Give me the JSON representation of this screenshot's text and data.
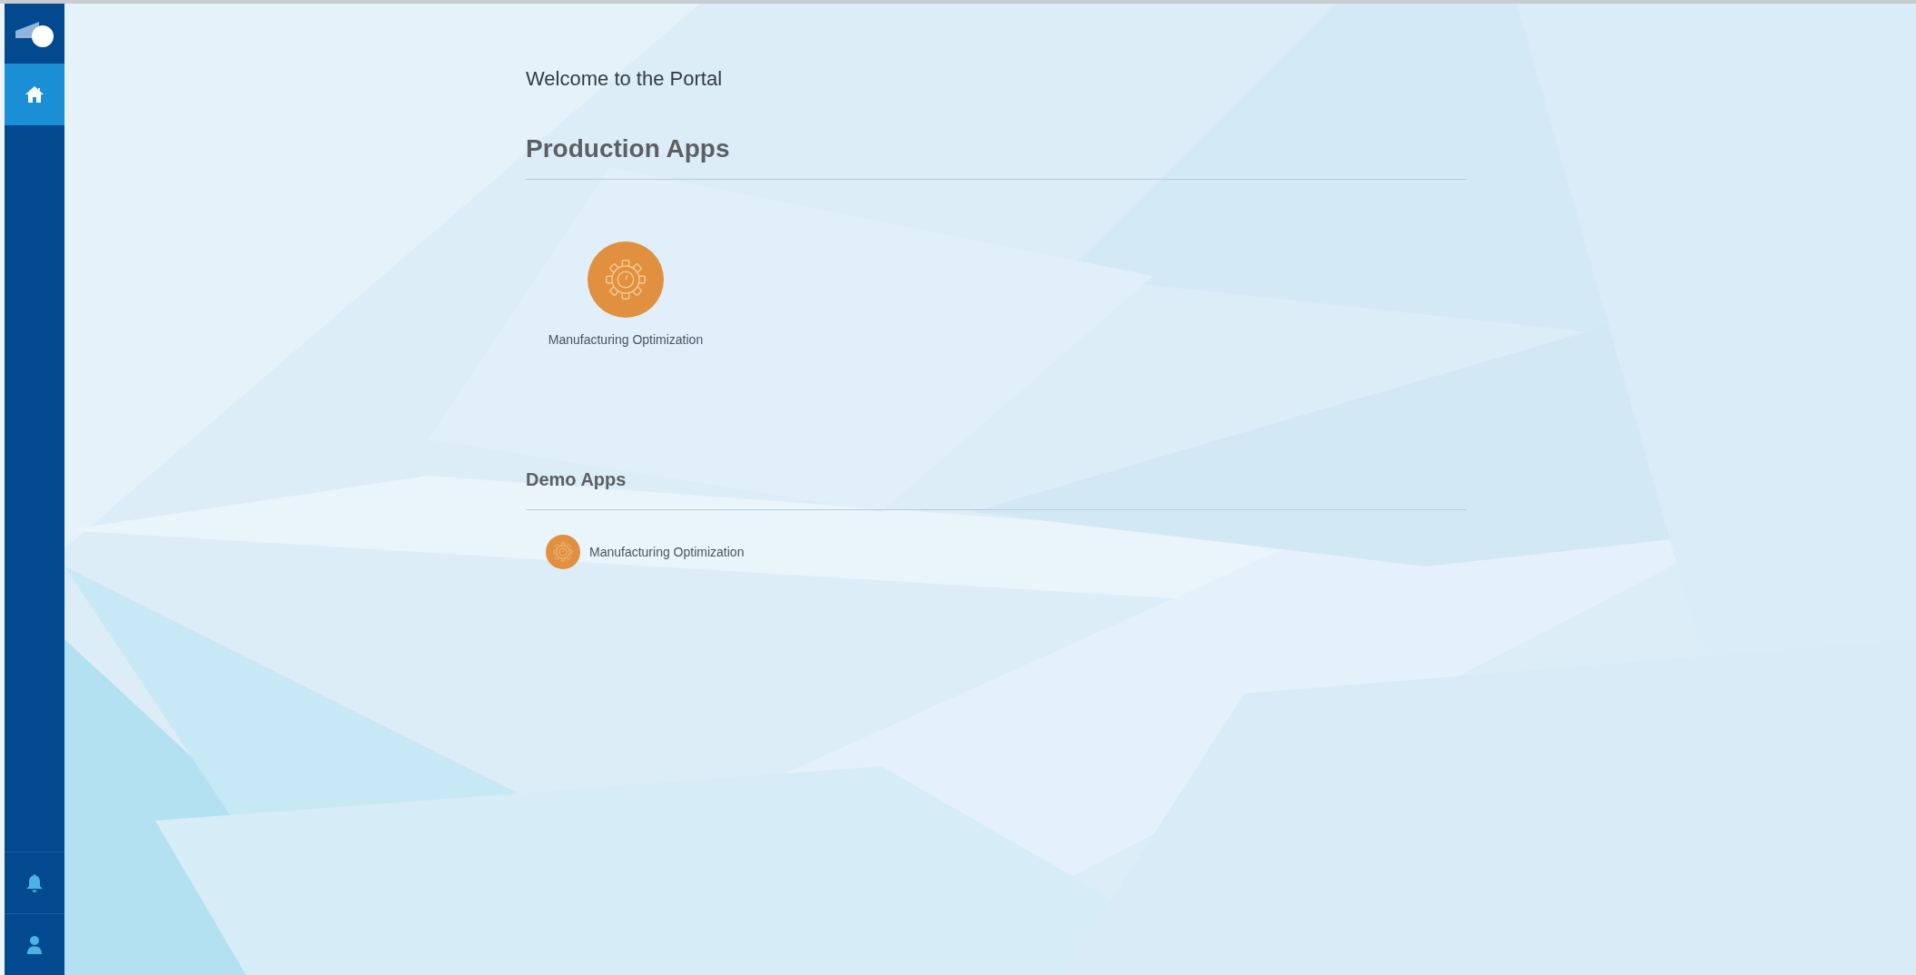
{
  "sidebar": {
    "items": [
      {
        "kind": "home",
        "selected": true
      }
    ],
    "bottom_items": [
      {
        "kind": "bell",
        "selected": false
      },
      {
        "kind": "user",
        "selected": false
      }
    ]
  },
  "welcome": "Welcome to the Portal",
  "sections": [
    {
      "title": "Production Apps",
      "kind": "tile",
      "apps": [
        {
          "label": "Manufacturing Optimization"
        }
      ]
    },
    {
      "title": "Demo Apps",
      "kind": "row",
      "apps": [
        {
          "label": "Manufacturing Optimization"
        }
      ]
    }
  ]
}
